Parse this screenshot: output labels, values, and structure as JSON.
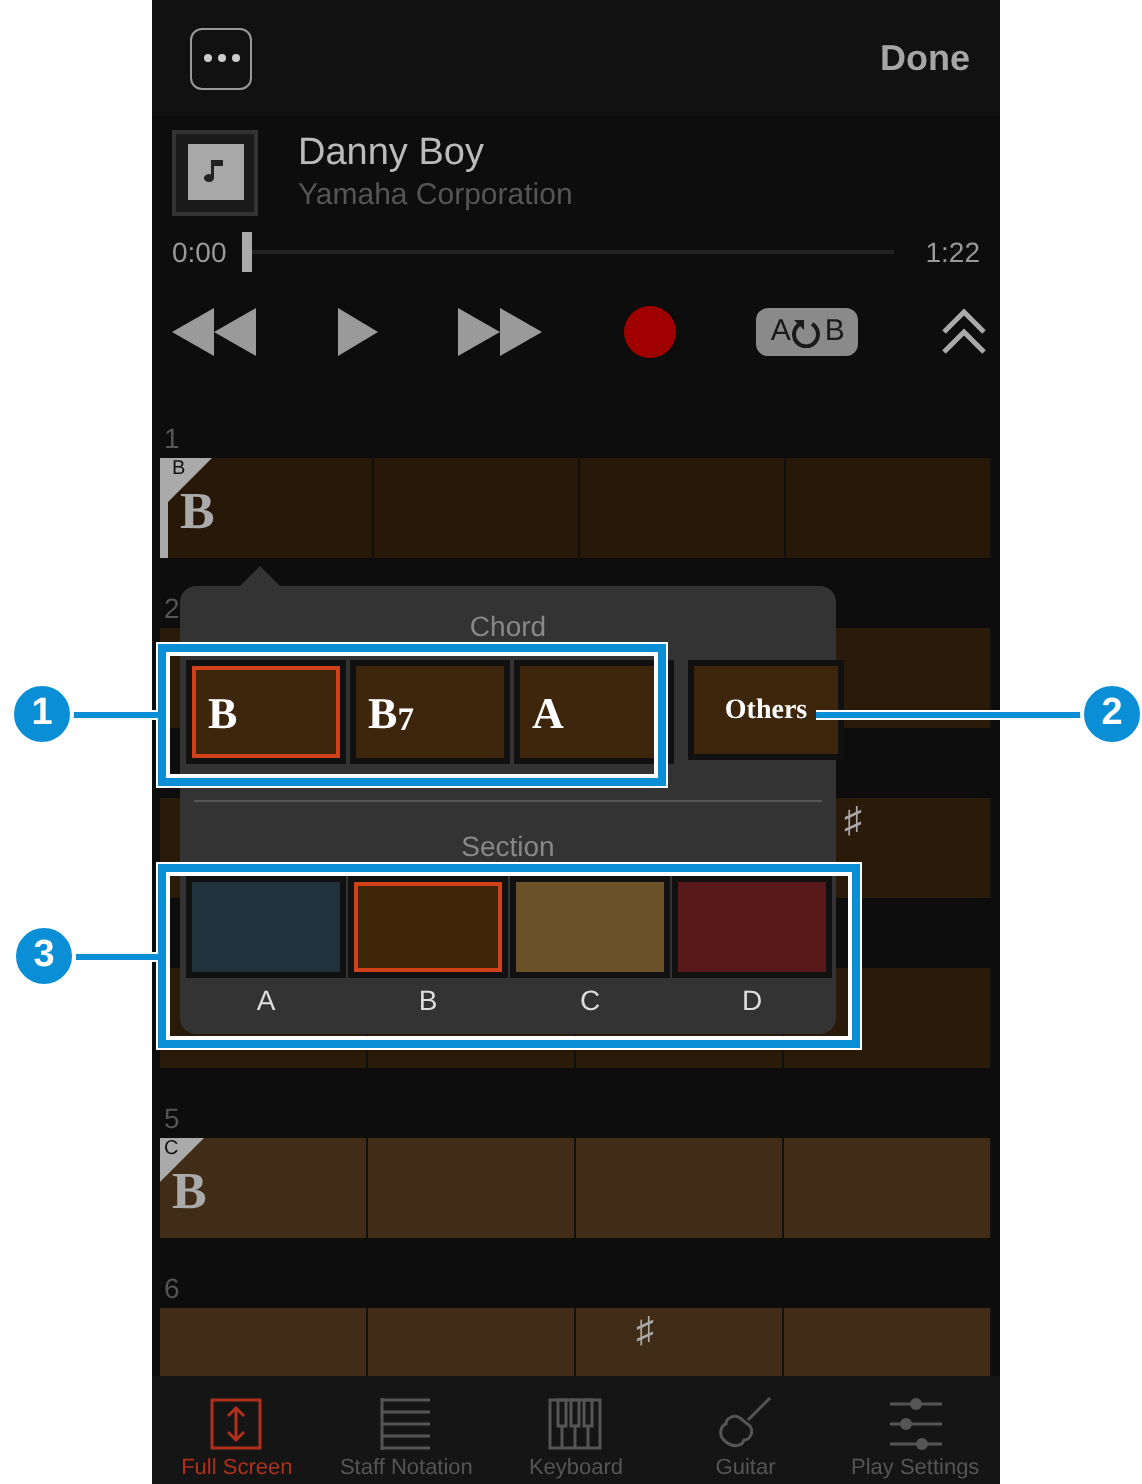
{
  "top_bar": {
    "done": "Done"
  },
  "song": {
    "title": "Danny Boy",
    "artist": "Yamaha Corporation"
  },
  "position": {
    "start": "0:00",
    "end": "1:22",
    "level": 0
  },
  "transport": {
    "ab_from": "A",
    "ab_to": "B"
  },
  "measures": [
    {
      "number": "1",
      "color": "#271808",
      "cursor": true,
      "cells": [
        {
          "section": "B",
          "chord": "B"
        },
        {},
        {},
        {}
      ]
    },
    {
      "number": "2",
      "color": "#2a1a09",
      "cursor": false,
      "cells": [
        {},
        {},
        {},
        {}
      ]
    },
    {
      "color": "#2a1a09",
      "cursor": false,
      "cells": [
        {},
        {},
        {},
        {
          "kind": "accidental",
          "chord": "♯"
        }
      ]
    },
    {
      "color": "#2a1a09",
      "cursor": false,
      "cells": [
        {},
        {},
        {},
        {}
      ]
    },
    {
      "number": "5",
      "color": "#412d17",
      "cursor": false,
      "cells": [
        {
          "section": "C",
          "chord": "B"
        },
        {},
        {},
        {}
      ]
    },
    {
      "number": "6",
      "color": "#412d17",
      "cursor": false,
      "cells": [
        {},
        {},
        {
          "kind": "accidental",
          "chord": "♯"
        },
        {}
      ]
    }
  ],
  "popover": {
    "chord_title": "Chord",
    "chords": [
      {
        "label": "B",
        "selected": true
      },
      {
        "label": "B$_{7}$",
        "selected": false
      },
      {
        "label": "A",
        "selected": false
      }
    ],
    "others": "Others",
    "section_title": "Section",
    "sections": [
      {
        "label": "A",
        "color": "#20323b",
        "selected": false
      },
      {
        "label": "B",
        "color": "#3f2609",
        "selected": true
      },
      {
        "label": "C",
        "color": "#6b5128",
        "selected": false
      },
      {
        "label": "D",
        "color": "#561818",
        "selected": false
      }
    ]
  },
  "tabs": [
    {
      "label": "Full Screen",
      "kind": "fullscreen",
      "selected": true
    },
    {
      "label": "Staff Notation",
      "kind": "staff",
      "selected": false
    },
    {
      "label": "Keyboard",
      "kind": "keyboard",
      "selected": false
    },
    {
      "label": "Guitar",
      "kind": "guitar",
      "selected": false
    },
    {
      "label": "Play Settings",
      "kind": "sliders",
      "selected": false
    }
  ],
  "callouts": [
    {
      "number": "1"
    },
    {
      "number": "2"
    },
    {
      "number": "3"
    }
  ]
}
